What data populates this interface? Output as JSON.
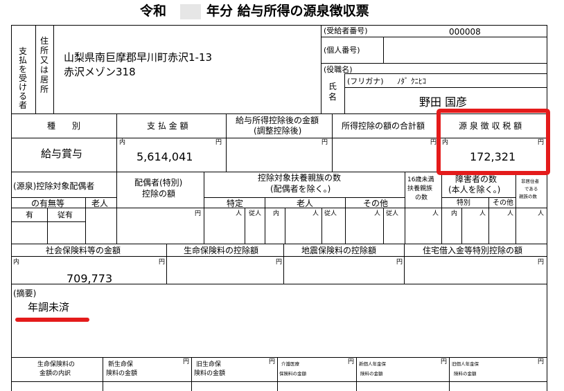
{
  "title": {
    "era": "令和",
    "year_masked": "",
    "rest": "年分  給与所得の源泉徴収票"
  },
  "payee": {
    "side_label": [
      "支払",
      "を受",
      "ける",
      "者"
    ],
    "addr_label": [
      "住",
      "所",
      "又",
      "は",
      "居",
      "所"
    ],
    "address_line1": "山梨県南巨摩郡早川町赤沢1-13",
    "address_line2": "赤沢メゾン318",
    "recipient_no_label": "(受給者番号)",
    "recipient_no": "000008",
    "personal_no_label": "(個人番号)",
    "position_label": "(役職名)",
    "name_label": [
      "氏",
      "名"
    ],
    "furigana_label": "(フリガナ)",
    "furigana": "ﾉﾀﾞ ｸﾆﾋｺ",
    "name": "野田 国彦"
  },
  "amounts": {
    "kind_label": "種　　別",
    "payment_label": "支 払 金 額",
    "after_deduction_label": "給与所得控除後の金額",
    "after_deduction_sub": "(調整控除後)",
    "deduction_total_label": "所得控除の額の合計額",
    "withholding_label": "源 泉 徴 収 税 額",
    "kind_value": "給与賞与",
    "naibun": "内",
    "yen": "円",
    "payment_value": "5,614,041",
    "withholding_value": "172,321"
  },
  "dependents": {
    "spouse_label1": "(源泉)控除対象配偶者",
    "spouse_label2": "の有無等",
    "elderly": "老人",
    "spouse_deduction_label1": "配偶者(特別)",
    "spouse_deduction_label2": "控除の額",
    "dependents_label1": "控除対象扶養親族の数",
    "dependents_label2": "(配偶者を除く。)",
    "specific": "特定",
    "elderly2": "老人",
    "other": "その他",
    "under16_1": "16歳未満",
    "under16_2": "扶養親族",
    "under16_3": "の数",
    "disabled_label1": "障害者の数",
    "disabled_label2": "(本人を除く。)",
    "special": "特別",
    "other2": "その他",
    "nonresident1": "非居住者",
    "nonresident2": "である",
    "nonresident3": "親族の数",
    "have": "有",
    "subordinate": "従有",
    "person": "人",
    "jujin": "従人",
    "inner": "内",
    "yen": "円"
  },
  "insurance": {
    "social_label": "社会保険料等の金額",
    "life_label": "生命保険料の控除額",
    "earthquake_label": "地震保険料の控除額",
    "housing_label": "住宅借入金等特別控除の額",
    "naibun": "内",
    "yen": "円",
    "social_value": "709,773"
  },
  "remarks": {
    "label": "(摘要)",
    "text": "年調未済"
  },
  "bottom": {
    "breakdown1": "生命保険料の",
    "breakdown2": "金額の内訳",
    "new_life1": "新生命保",
    "new_life2": "険料の金額",
    "old_life1": "旧生命保",
    "old_life2": "険料の金額",
    "care1": "介護医療",
    "care2": "保険料の金額",
    "new_pension1": "新個人年金保",
    "new_pension2": "険料の金額",
    "old_pension1": "旧個人年金保",
    "old_pension2": "険料の金額",
    "yen": "円"
  },
  "colors": {
    "highlight": "#e41b1b",
    "masked_box": "#e6e6e6"
  }
}
